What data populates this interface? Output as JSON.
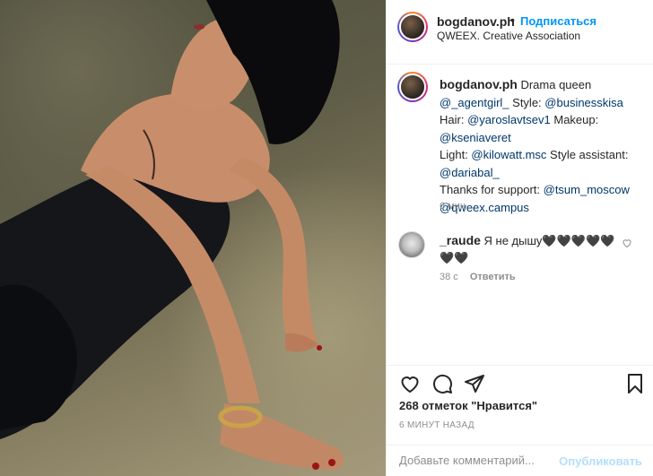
{
  "post": {
    "header": {
      "username": "bogdanov.ph",
      "separator": "•",
      "follow_label": "Подписаться",
      "location": "QWEEX. Creative Association"
    },
    "caption": {
      "username": "bogdanov.ph",
      "text_1": " Drama queen ",
      "mention_1": "@_agentgirl_",
      "text_2": " Style: ",
      "mention_2": "@businesskisa",
      "text_3": " Hair: ",
      "mention_3": "@yaroslavtsev1",
      "text_4": " Makeup: ",
      "mention_4": "@kseniaveret",
      "text_5": " Light: ",
      "mention_5": "@kilowatt.msc",
      "text_6": " Style assistant: ",
      "mention_6": "@dariabal_",
      "text_7": " Thanks for support: ",
      "mention_7": "@tsum_moscow",
      "mention_8": "@qweex.campus",
      "time": "6 мин."
    },
    "comment": {
      "username": "_raude",
      "text": " Я не дышу🖤🖤🖤🖤🖤🖤🖤",
      "time": "38 с",
      "reply_label": "Ответить"
    },
    "likes_text": "268 отметок \"Нравится\"",
    "posted_ago": "6 МИНУТ НАЗАД",
    "add_comment": {
      "placeholder": "Добавьте комментарий...",
      "publish_label": "Опубликовать"
    },
    "icons": [
      "heart-icon",
      "comment-icon",
      "share-icon",
      "bookmark-icon"
    ]
  }
}
